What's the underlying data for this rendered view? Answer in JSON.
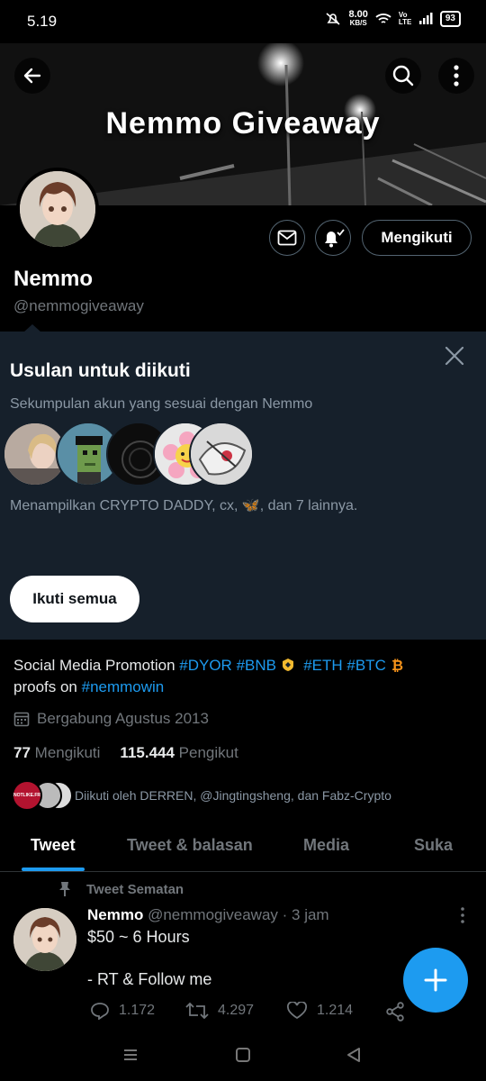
{
  "status_bar": {
    "time": "5.19",
    "net_speed_value": "8.00",
    "net_speed_unit": "KB/S",
    "volte": "Vo LTE",
    "battery": "93"
  },
  "banner": {
    "title": "Nemmo Giveaway"
  },
  "profile": {
    "name": "Nemmo",
    "handle": "@nemmogiveaway",
    "follow_state": "Mengikuti"
  },
  "suggestions": {
    "title": "Usulan untuk diikuti",
    "subtitle": "Sekumpulan akun yang sesuai dengan Nemmo",
    "description": "Menampilkan CRYPTO DADDY, cx, 🦋, dan 7 lainnya.",
    "follow_all": "Ikuti semua"
  },
  "bio": {
    "text1": "Social Media Promotion ",
    "tag1": "#DYOR",
    "tag2": "#BNB",
    "tag3": "#ETH",
    "tag4": "#BTC",
    "text2": "proofs on ",
    "tag5": "#nemmowin",
    "joined": "Bergabung Agustus 2013"
  },
  "counts": {
    "following_value": "77",
    "following_label": "Mengikuti",
    "followers_value": "115.444",
    "followers_label": "Pengikut"
  },
  "followed_by": {
    "text": "Diikuti oleh DERREN, @Jingtingsheng, dan Fabz-Crypto",
    "badge": "NOTLIKE.FR"
  },
  "tabs": [
    {
      "label": "Tweet"
    },
    {
      "label": "Tweet & balasan"
    },
    {
      "label": "Media"
    },
    {
      "label": "Suka"
    }
  ],
  "tweet": {
    "pinned_label": "Tweet Sematan",
    "name": "Nemmo",
    "meta": "@nemmogiveaway · 3 jam",
    "line1": "$50 ~ 6 Hours",
    "line2": "- RT & Follow me",
    "replies": "1.172",
    "retweets": "4.297",
    "likes": "1.214"
  },
  "colors": {
    "accent": "#1d9bf0",
    "background": "#000000",
    "card": "#16202b",
    "muted": "#71767b"
  }
}
